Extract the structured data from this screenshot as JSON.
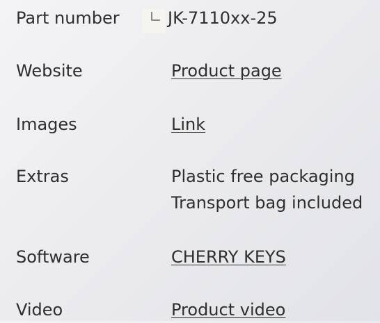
{
  "specs": {
    "part_number": {
      "label": "Part number",
      "value": "JK-7110xx-25"
    },
    "website": {
      "label": "Website",
      "link": "Product page"
    },
    "images": {
      "label": "Images",
      "link": "Link"
    },
    "extras": {
      "label": "Extras",
      "lines": [
        "Plastic free packaging",
        "Transport bag included"
      ]
    },
    "software": {
      "label": "Software",
      "link": "CHERRY KEYS"
    },
    "video": {
      "label": "Video",
      "link": "Product video"
    }
  },
  "icons": {
    "part_number_icon": "copy-corner-icon"
  }
}
